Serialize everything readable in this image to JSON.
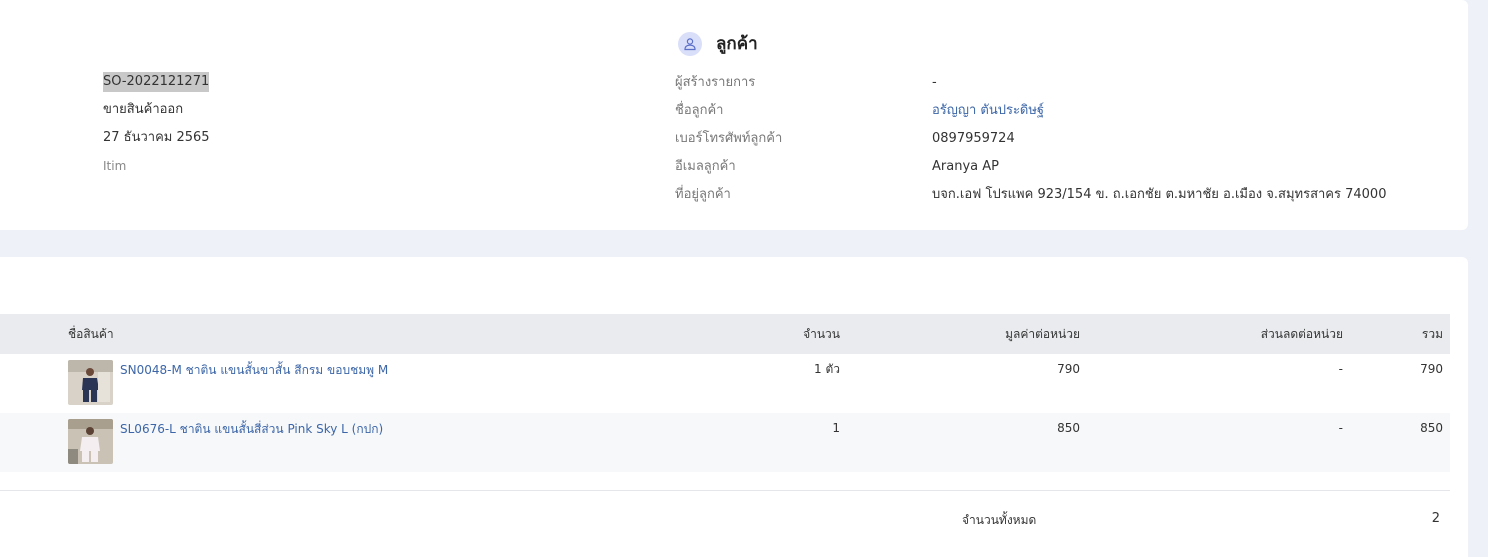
{
  "order": {
    "number": "SO-2022121271",
    "type": "ขายสินค้าออก",
    "date": "27 ธันวาคม 2565",
    "channel": "Itim"
  },
  "customer": {
    "section_title": "ลูกค้า",
    "icon": "user-icon",
    "labels": {
      "creator": "ผู้สร้างรายการ",
      "name": "ชื่อลูกค้า",
      "phone": "เบอร์โทรศัพท์ลูกค้า",
      "email": "อีเมลลูกค้า",
      "address": "ที่อยู่ลูกค้า"
    },
    "values": {
      "creator": "-",
      "name": "อรัญญา ตันประดิษฐ์",
      "phone": "0897959724",
      "email": "Aranya AP",
      "address": "บจก.เอฟ โปรแพค 923/154 ข. ถ.เอกชัย ต.มหาชัย อ.เมือง จ.สมุทรสาคร 74000"
    }
  },
  "table": {
    "headers": {
      "product": "ชื่อสินค้า",
      "qty": "จำนวน",
      "unit_price": "มูลค่าต่อหน่วย",
      "discount": "ส่วนลดต่อหน่วย",
      "total": "รวม"
    },
    "rows": [
      {
        "name": "SN0048-M ชาติน แขนสั้นขาสั้น สีกรม ขอบชมพู M",
        "qty": "1 ตัว",
        "unit_price": "790",
        "discount": "-",
        "total": "790"
      },
      {
        "name": "SL0676-L ชาติน แขนสั้นสี่ส่วน Pink Sky L (กปก)",
        "qty": "1",
        "unit_price": "850",
        "discount": "-",
        "total": "850"
      }
    ]
  },
  "summary": {
    "label": "จำนวนทั้งหมด",
    "value": "2"
  },
  "colors": {
    "accent_link": "#3c66a8",
    "page_bg": "#eef1f8",
    "header_bg": "#e9ebee"
  }
}
